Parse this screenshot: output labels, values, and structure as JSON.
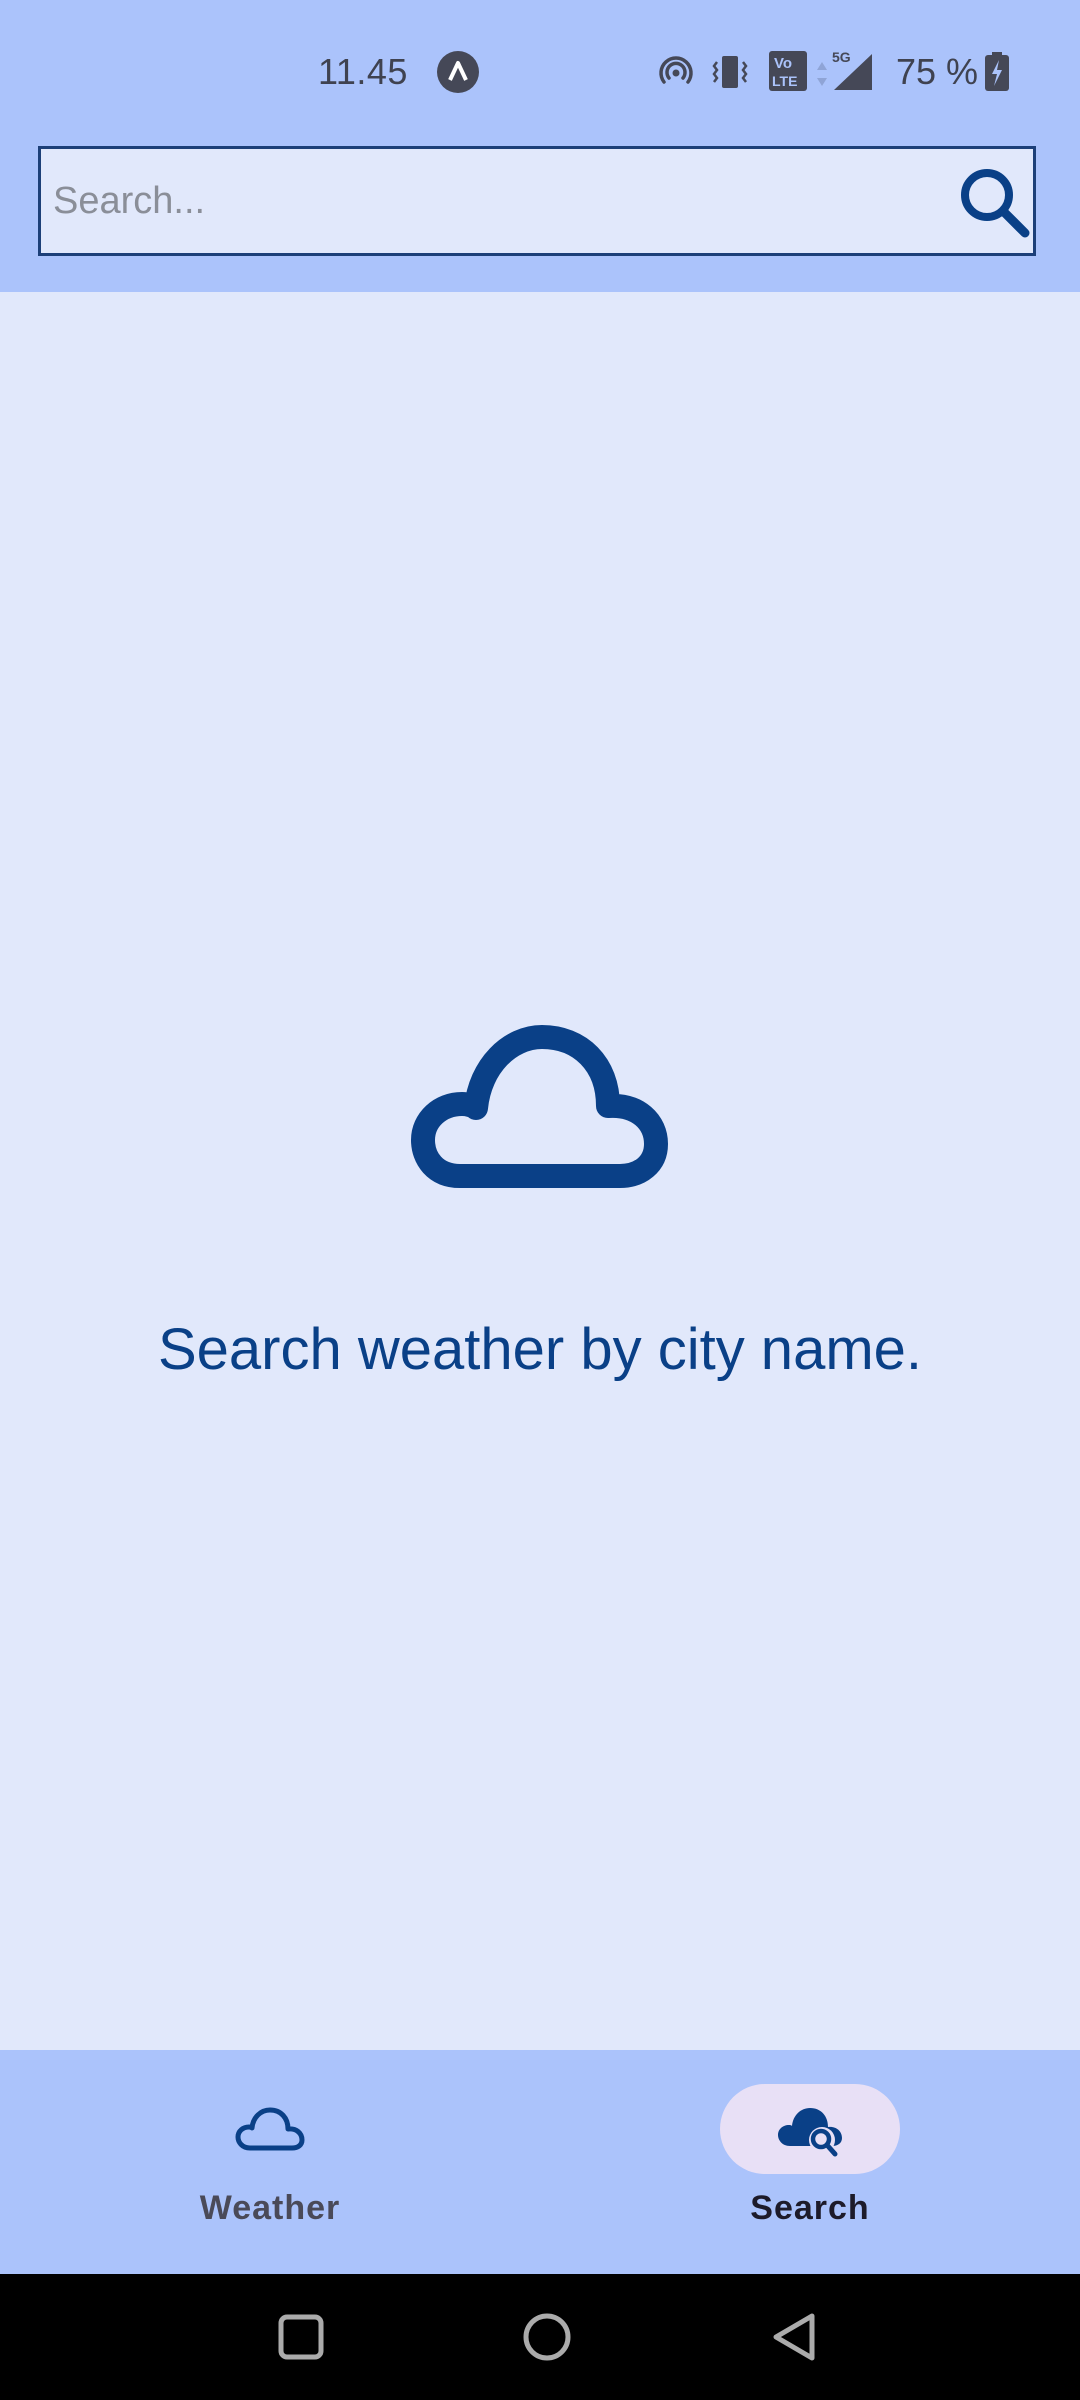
{
  "status_bar": {
    "time": "11.45",
    "battery_percent": "75 %",
    "network_label": "5G",
    "volte_label_top": "Vo",
    "volte_label_bottom": "LTE",
    "icons": [
      "app-notification-icon",
      "hotspot-icon",
      "vibrate-icon",
      "volte-icon",
      "signal-icon",
      "battery-charging-icon"
    ]
  },
  "search": {
    "placeholder": "Search...",
    "value": ""
  },
  "empty_state": {
    "icon": "cloud-icon",
    "message": "Search weather by city name."
  },
  "bottom_nav": {
    "items": [
      {
        "label": "Weather",
        "icon": "cloud-icon",
        "selected": false
      },
      {
        "label": "Search",
        "icon": "cloud-search-icon",
        "selected": true
      }
    ]
  },
  "colors": {
    "app_bar": "#abc3fb",
    "background": "#e1e8fb",
    "primary": "#0a4087",
    "selected_pill": "#e8e0f6"
  }
}
